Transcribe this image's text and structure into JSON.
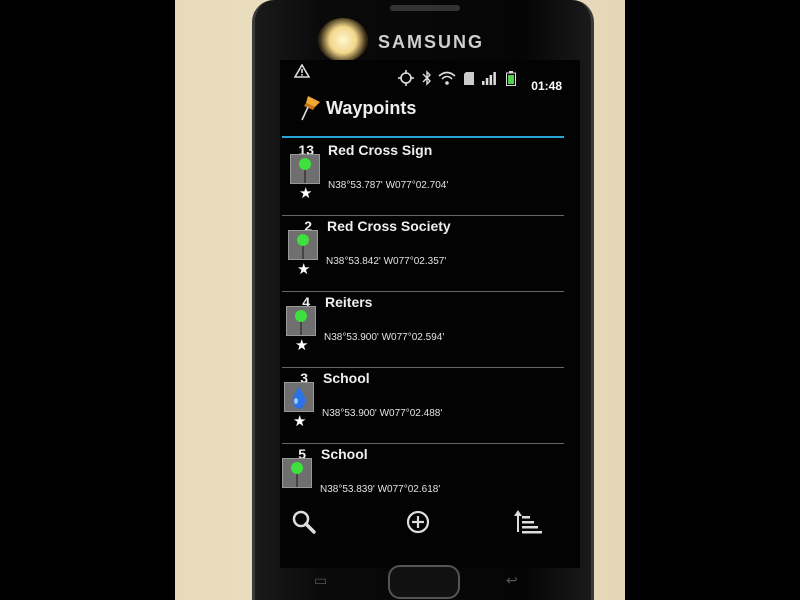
{
  "device": {
    "brand": "SAMSUNG"
  },
  "status_bar": {
    "time": "01:48",
    "icons": [
      "warning-icon",
      "gps-icon",
      "bluetooth-icon",
      "wifi-icon",
      "sd-card-icon",
      "signal-icon",
      "battery-icon"
    ]
  },
  "app": {
    "title": "Waypoints",
    "title_icon": "pushpin-icon",
    "accent_color": "#28a4d8"
  },
  "waypoints": [
    {
      "number": "13",
      "name": "Red Cross Sign",
      "coords": "N38°53.787' W077°02.704'",
      "icon": "green-pin-icon",
      "favorite": true
    },
    {
      "number": "2",
      "name": "Red Cross Society",
      "coords": "N38°53.842' W077°02.357'",
      "icon": "green-pin-icon",
      "favorite": true
    },
    {
      "number": "4",
      "name": "Reiters",
      "coords": "N38°53.900' W077°02.594'",
      "icon": "green-pin-icon",
      "favorite": true
    },
    {
      "number": "3",
      "name": "School",
      "coords": "N38°53.900' W077°02.488'",
      "icon": "blue-drop-icon",
      "favorite": true
    },
    {
      "number": "5",
      "name": "School",
      "coords": "N38°53.839' W077°02.618'",
      "icon": "green-pin-icon",
      "favorite": true
    }
  ],
  "toolbar": {
    "actions": [
      "search-icon",
      "add-icon",
      "sort-icon"
    ]
  }
}
